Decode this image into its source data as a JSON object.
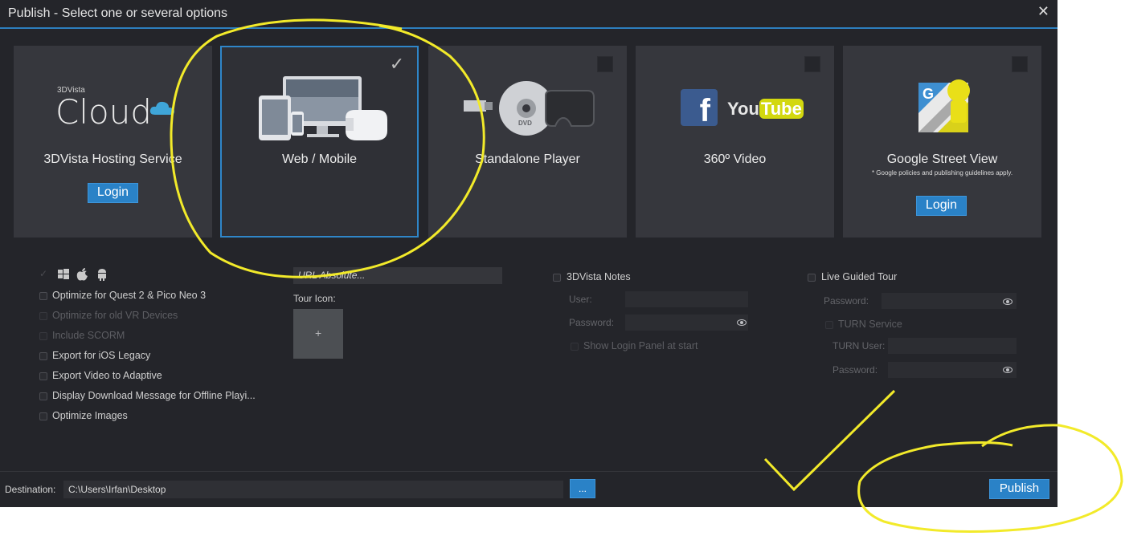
{
  "window": {
    "title": "Publish - Select one or several options",
    "close_glyph": "✕"
  },
  "cards": {
    "cloud": {
      "brand_small": "3DVista",
      "brand_large": "Cloud",
      "label": "3DVista Hosting Service",
      "button": "Login"
    },
    "web": {
      "label": "Web / Mobile",
      "selected": true
    },
    "standalone": {
      "label": "Standalone Player",
      "dvd_text": "DVD"
    },
    "video": {
      "label": "360º Video",
      "youtube_you": "You",
      "youtube_tube": "Tube",
      "facebook_letter": "f"
    },
    "streetview": {
      "label": "Google Street View",
      "note": "* Google policies and publishing guidelines apply.",
      "button": "Login",
      "g_letter": "G"
    }
  },
  "options": {
    "platforms_label": "",
    "items": [
      {
        "label": "Optimize for Quest 2 & Pico Neo 3",
        "enabled": true
      },
      {
        "label": "Optimize for old VR Devices",
        "enabled": false
      },
      {
        "label": "Include SCORM",
        "enabled": false
      },
      {
        "label": "Export for iOS Legacy",
        "enabled": true
      },
      {
        "label": "Export Video to Adaptive",
        "enabled": true
      },
      {
        "label": "Display Download Message for Offline Playi...",
        "enabled": true
      },
      {
        "label": "Optimize Images",
        "enabled": true
      }
    ]
  },
  "url_field": {
    "placeholder": "URL Absolute..."
  },
  "tour_icon": {
    "label": "Tour Icon:",
    "add": "+"
  },
  "notes": {
    "title": "3DVista Notes",
    "user_label": "User:",
    "password_label": "Password:",
    "show_login": "Show Login Panel at start"
  },
  "live": {
    "title": "Live Guided Tour",
    "password_label": "Password:",
    "turn_service": "TURN Service",
    "turn_user_label": "TURN User:",
    "turn_password_label": "Password:"
  },
  "destination": {
    "label": "Destination:",
    "value": "C:\\Users\\Irfan\\Desktop",
    "browse": "..."
  },
  "publish_button": "Publish",
  "colors": {
    "accent": "#2a82c7",
    "highlight_annotation": "#f2ea2a",
    "background": "#24252a",
    "card": "#36373d"
  }
}
